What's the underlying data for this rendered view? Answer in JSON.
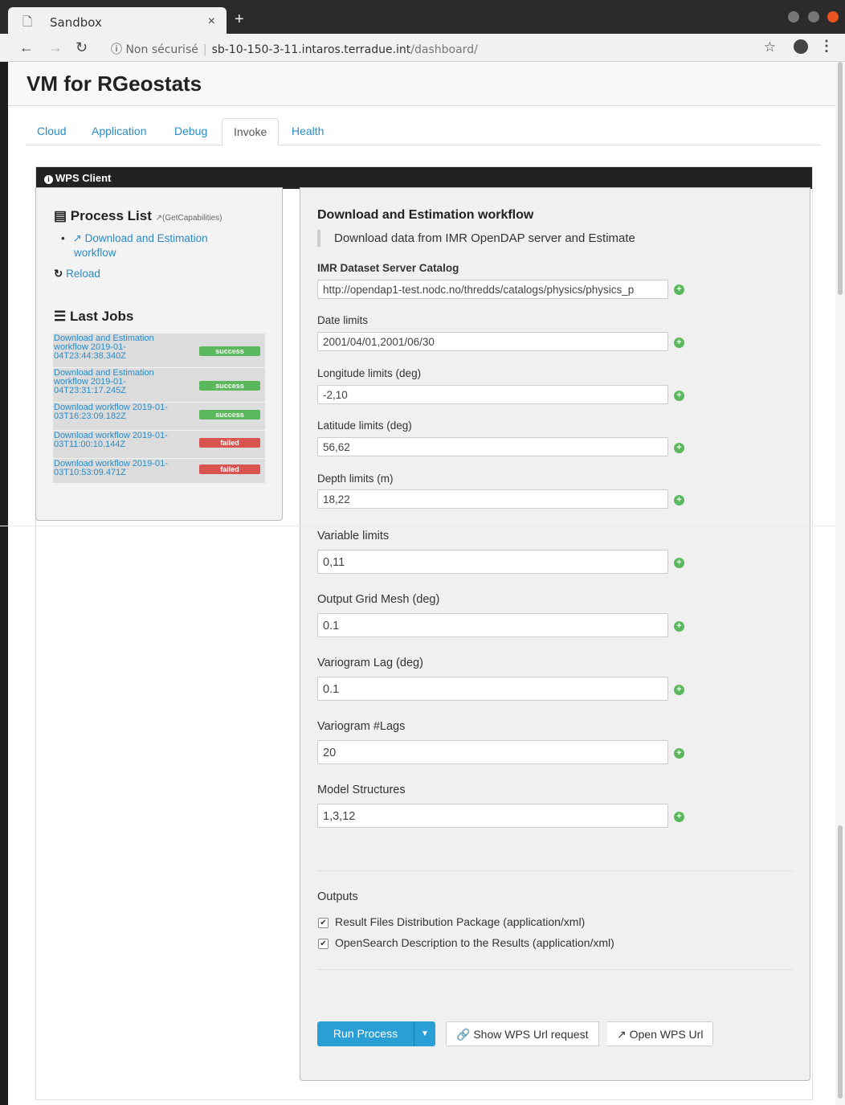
{
  "browser": {
    "tab_title": "Sandbox",
    "tab_close": "×",
    "new_tab": "+",
    "security": "Non sécurisé",
    "url_host": "sb-10-150-3-11.intaros.terradue.int",
    "url_path": "/dashboard/",
    "colors": {
      "close": "#e95420",
      "min": "#777777",
      "max": "#777777"
    }
  },
  "page": {
    "title": "VM for RGeostats",
    "tabs": [
      "Cloud",
      "Application",
      "Debug",
      "Invoke",
      "Health"
    ],
    "active_tab": "Invoke"
  },
  "panel": {
    "title": "WPS Client"
  },
  "sidebar": {
    "process_list_title": "Process List",
    "get_capabilities": "(GetCapabilities)",
    "process_link": "Download and Estimation",
    "process_link_2": "workflow",
    "reload": "Reload",
    "last_jobs_title": "Last Jobs",
    "jobs": [
      {
        "name": "Download and Estimation workflow 2019-01-04T23:44:38.340Z",
        "status": "success"
      },
      {
        "name": "Download and Estimation workflow 2019-01-04T23:31:17.245Z",
        "status": "success"
      },
      {
        "name": "Download workflow 2019-01-03T16:23:09.182Z",
        "status": "success"
      },
      {
        "name": "Download workflow 2019-01-03T11:00:10.144Z",
        "status": "failed"
      },
      {
        "name": "Download workflow 2019-01-03T10:53:09.471Z",
        "status": "failed"
      }
    ]
  },
  "form": {
    "title": "Download and Estimation workflow",
    "description": "Download data from IMR OpenDAP server and Estimate",
    "fields": [
      {
        "label": "IMR Dataset Server Catalog",
        "value": "http://opendap1-test.nodc.no/thredds/catalogs/physics/physics_p"
      },
      {
        "label": "Date limits",
        "value": "2001/04/01,2001/06/30"
      },
      {
        "label": "Longitude limits (deg)",
        "value": "-2,10"
      },
      {
        "label": "Latitude limits (deg)",
        "value": "56,62"
      },
      {
        "label": "Depth limits (m)",
        "value": "18,22"
      },
      {
        "label": "Variable limits",
        "value": "0,11"
      },
      {
        "label": "Output Grid Mesh (deg)",
        "value": "0.1"
      },
      {
        "label": "Variogram Lag (deg)",
        "value": "0.1"
      },
      {
        "label": "Variogram #Lags",
        "value": "20"
      },
      {
        "label": "Model Structures",
        "value": "1,3,12"
      }
    ],
    "outputs_title": "Outputs",
    "outputs": [
      {
        "label": "Result Files Distribution Package (application/xml)",
        "checked": true
      },
      {
        "label": "OpenSearch Description to the Results (application/xml)",
        "checked": true
      }
    ],
    "run_label": "Run Process",
    "show_url_label": "Show WPS Url request",
    "open_url_label": "Open WPS Url"
  }
}
